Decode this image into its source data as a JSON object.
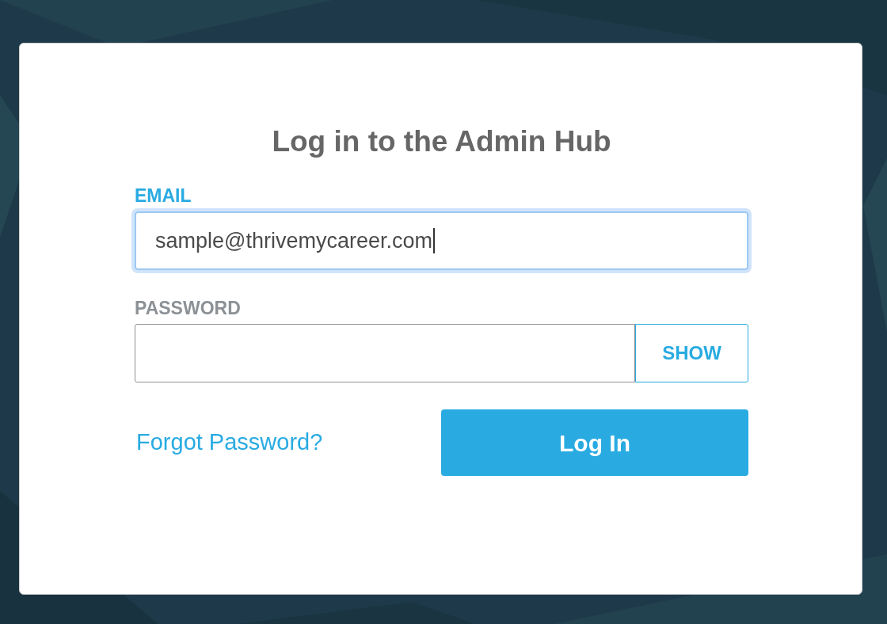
{
  "title": "Log in to the Admin Hub",
  "fields": [
    {
      "kind": "text",
      "label": "EMAIL",
      "value": "sample@thrivemycareer.com",
      "focused": true
    },
    {
      "kind": "password",
      "label": "PASSWORD",
      "toggle": "SHOW",
      "focused": false
    }
  ],
  "forgot_link": "Forgot Password?",
  "login_button": "Log In"
}
